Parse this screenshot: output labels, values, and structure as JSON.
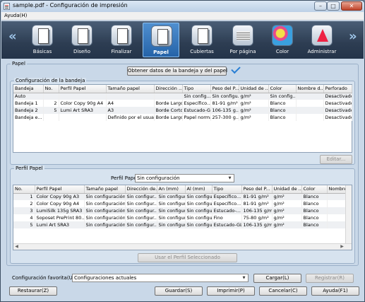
{
  "window": {
    "title": "sample.pdf - Configuración de impresión",
    "minimize": "–",
    "maximize": "□",
    "close": "✕"
  },
  "menu": {
    "items": [
      {
        "label": "Ayuda(H)"
      }
    ]
  },
  "toolbar": {
    "prev": "«",
    "next": "»",
    "tabs": [
      {
        "label": "Básicas",
        "icon": "basic-settings-icon"
      },
      {
        "label": "Diseño",
        "icon": "layout-icon"
      },
      {
        "label": "Finalizar",
        "icon": "finishing-icon"
      },
      {
        "label": "Papel",
        "icon": "paper-icon",
        "active": true
      },
      {
        "label": "Cubiertas",
        "icon": "cover-icon"
      },
      {
        "label": "Por página",
        "icon": "per-page-icon"
      },
      {
        "label": "Color",
        "icon": "color-icon"
      },
      {
        "label": "Administrar",
        "icon": "administration-icon"
      }
    ]
  },
  "paper": {
    "group_label": "Papel",
    "get_tray_button": "Obtener datos de la bandeja y del papel",
    "tray": {
      "group_label": "Configuración de la bandeja",
      "columns": [
        "Bandeja",
        "No.",
        "Perfil Papel",
        "Tamaño papel",
        "Dirección ...",
        "Tipo",
        "Peso del P...",
        "Unidad de ...",
        "Color",
        "Nombre d...",
        "Perforado"
      ],
      "rows": [
        [
          "Auto",
          "",
          "",
          "",
          "",
          "Sin config...",
          "Sin configu...",
          "g/m²",
          "Sin config...",
          "",
          "Desactivado"
        ],
        [
          "Bandeja 1",
          "2",
          "Color Copy 90g A4",
          "A4",
          "Borde Largo",
          "Específico...",
          "81-91 g/m²",
          "g/m²",
          "Blanco",
          "",
          "Desactivado"
        ],
        [
          "Bandeja 2",
          "5",
          "Lumi Art SRA3",
          "A3",
          "Borde Corto",
          "Estucado-GL",
          "106-135 g...",
          "g/m²",
          "Blanco",
          "",
          "Desactivado"
        ],
        [
          "Bandeja e...",
          "",
          "",
          "Definido por el usuario",
          "Borde Largo",
          "Papel normal",
          "257-300 g...",
          "g/m²",
          "Blanco",
          "",
          "Desactivado"
        ]
      ],
      "edit_button": "Editar..."
    },
    "profile": {
      "group_label": "Perfil Papel",
      "select_label": "Perfil Papel",
      "select_value": "Sin configuración",
      "columns": [
        "No.",
        "Perfil Papel",
        "Tamaño papel",
        "Dirección de...",
        "An (mm)",
        "Al (mm)",
        "Tipo",
        "Peso del P...",
        "Unidad de ...",
        "Color",
        "Nombre ..."
      ],
      "rows": [
        [
          "1",
          "Color Copy 90g A3",
          "Sin configuración",
          "Sin configur...",
          "Sin configur...",
          "Sin configur...",
          "Específico...",
          "81-91 g/m²",
          "g/m²",
          "Blanco",
          ""
        ],
        [
          "2",
          "Color Copy 90g A4",
          "Sin configuración",
          "Sin configur...",
          "Sin configur...",
          "Sin configur...",
          "Específico...",
          "81-91 g/m²",
          "g/m²",
          "Blanco",
          ""
        ],
        [
          "3",
          "LumiSilk 135g SRA3",
          "Sin configuración",
          "Sin configur...",
          "Sin configur...",
          "Sin configur...",
          "Estucado-...",
          "106-135 g/m²",
          "g/m²",
          "Blanco",
          ""
        ],
        [
          "4",
          "Soposet PrePrint 80...",
          "Sin configuración",
          "Sin configur...",
          "Sin configur...",
          "Sin configur...",
          "Fino",
          "75-80 g/m²",
          "g/m²",
          "Blanco",
          ""
        ],
        [
          "5",
          "Lumi Art SRA3",
          "Sin configuración",
          "Sin configur...",
          "Sin configur...",
          "Sin configur...",
          "Estucado-GL",
          "106-135 g/m²",
          "g/m²",
          "Blanco",
          ""
        ]
      ],
      "use_button": "Usar el Perfil Seleccionado"
    }
  },
  "favorites": {
    "label": "Configuración favorita(U)",
    "value": "Configuraciones actuales",
    "load_button": "Cargar(L)",
    "register_button": "Registrar(R)"
  },
  "footer": {
    "restore_button": "Restaurar(Z)",
    "save_button": "Guardar(S)",
    "print_button": "Imprimir(P)",
    "cancel_button": "Cancelar(C)",
    "help_button": "Ayuda(F1)"
  },
  "colors": {
    "accent": "#2a7fd4",
    "toolbar_bg": "#2d3d52",
    "window_bg": "#c9d8e8"
  }
}
